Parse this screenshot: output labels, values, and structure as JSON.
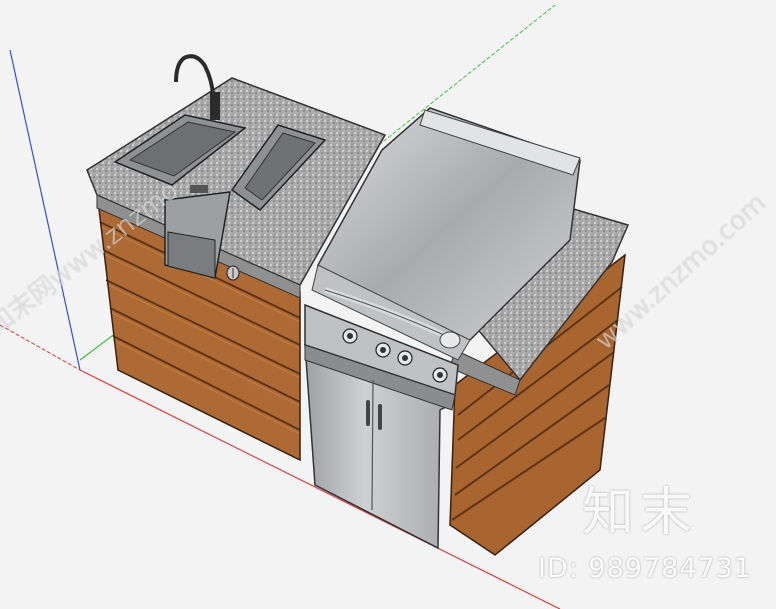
{
  "watermark": {
    "brand": "知末",
    "id_text": "ID: 989784731",
    "diagonal_left": "知末网www.znzmo",
    "diagonal_right": "www.znzmo.com"
  },
  "colors": {
    "background": "#f3f3f3",
    "granite": "#a9aaa9",
    "wood": "#b06a33",
    "wood_dark": "#6e3e1b",
    "steel": "#b8babd",
    "axis_green": "#3cc23c",
    "axis_red": "#d83b3b",
    "axis_blue": "#3b4bd8"
  }
}
